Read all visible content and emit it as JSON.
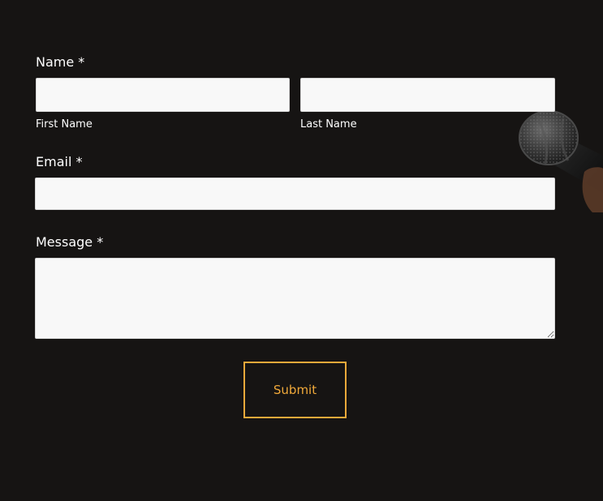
{
  "form": {
    "name": {
      "label": "Name",
      "required_marker": "*",
      "first": {
        "value": "",
        "sublabel": "First Name"
      },
      "last": {
        "value": "",
        "sublabel": "Last Name"
      }
    },
    "email": {
      "label": "Email",
      "required_marker": "*",
      "value": ""
    },
    "message": {
      "label": "Message",
      "required_marker": "*",
      "value": ""
    },
    "submit_label": "Submit"
  },
  "decoration": {
    "image": "microphone-image"
  },
  "colors": {
    "background": "#161413",
    "accent": "#f0a93a",
    "field_bg": "#f8f8f8",
    "text": "#ffffff"
  }
}
